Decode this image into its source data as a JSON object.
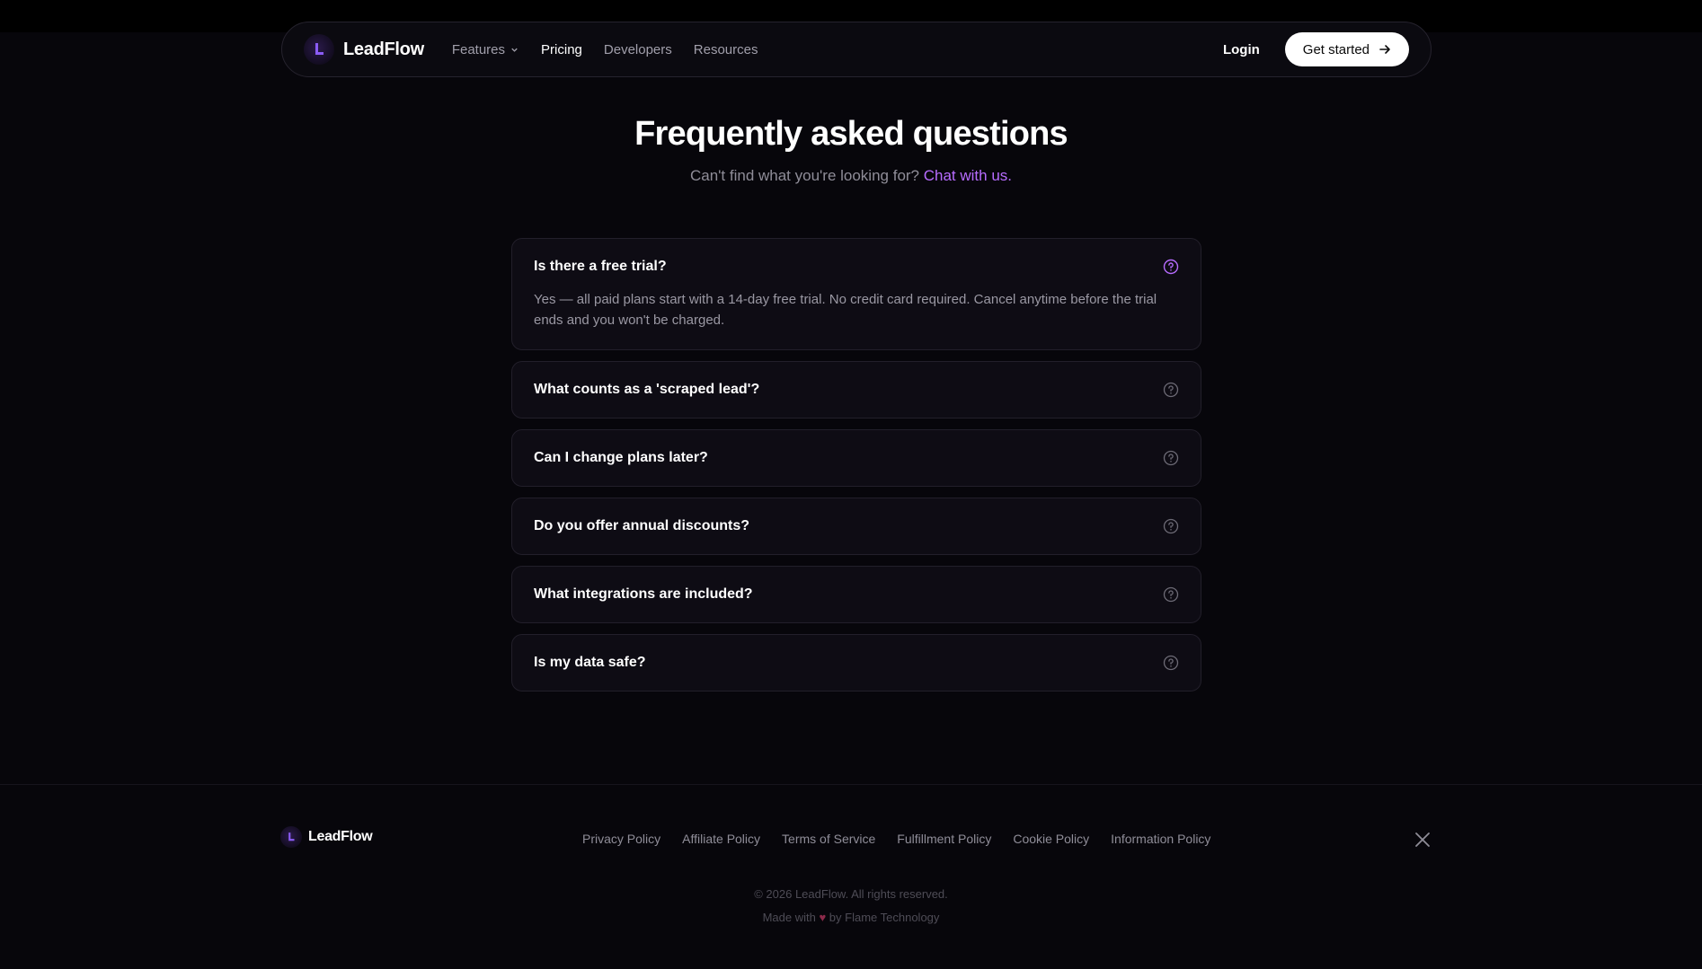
{
  "nav": {
    "logo_text": "LeadFlow",
    "links": [
      {
        "label": "Features"
      },
      {
        "label": "Pricing"
      },
      {
        "label": "Developers"
      },
      {
        "label": "Resources"
      }
    ],
    "login": "Login",
    "cta": "Get started"
  },
  "hero": {
    "title": "Frequently asked questions",
    "subtitle": "Can't find what you're looking for?",
    "subtitle_link": "Chat with us."
  },
  "faq": {
    "items": [
      {
        "question": "Is there a free trial?",
        "answer": "Yes — all paid plans start with a 14-day free trial. No credit card required. Cancel anytime before the trial ends and you won't be charged."
      },
      {
        "question": "What counts as a 'scraped lead'?"
      },
      {
        "question": "Can I change plans later?"
      },
      {
        "question": "Do you offer annual discounts?"
      },
      {
        "question": "What integrations are included?"
      },
      {
        "question": "Is my data safe?"
      }
    ]
  },
  "footer": {
    "logo_text": "LeadFlow",
    "links": [
      "Privacy Policy",
      "Affiliate Policy",
      "Terms of Service",
      "Fulfillment Policy",
      "Cookie Policy",
      "Information Policy"
    ],
    "copyright": "© 2026 LeadFlow. All rights reserved.",
    "made_prefix": "Made with",
    "made_suffix": "by Flame Technology"
  },
  "colors": {
    "background": "#07060b",
    "accent": "#b76cff",
    "heart": "#8b2a4a"
  }
}
